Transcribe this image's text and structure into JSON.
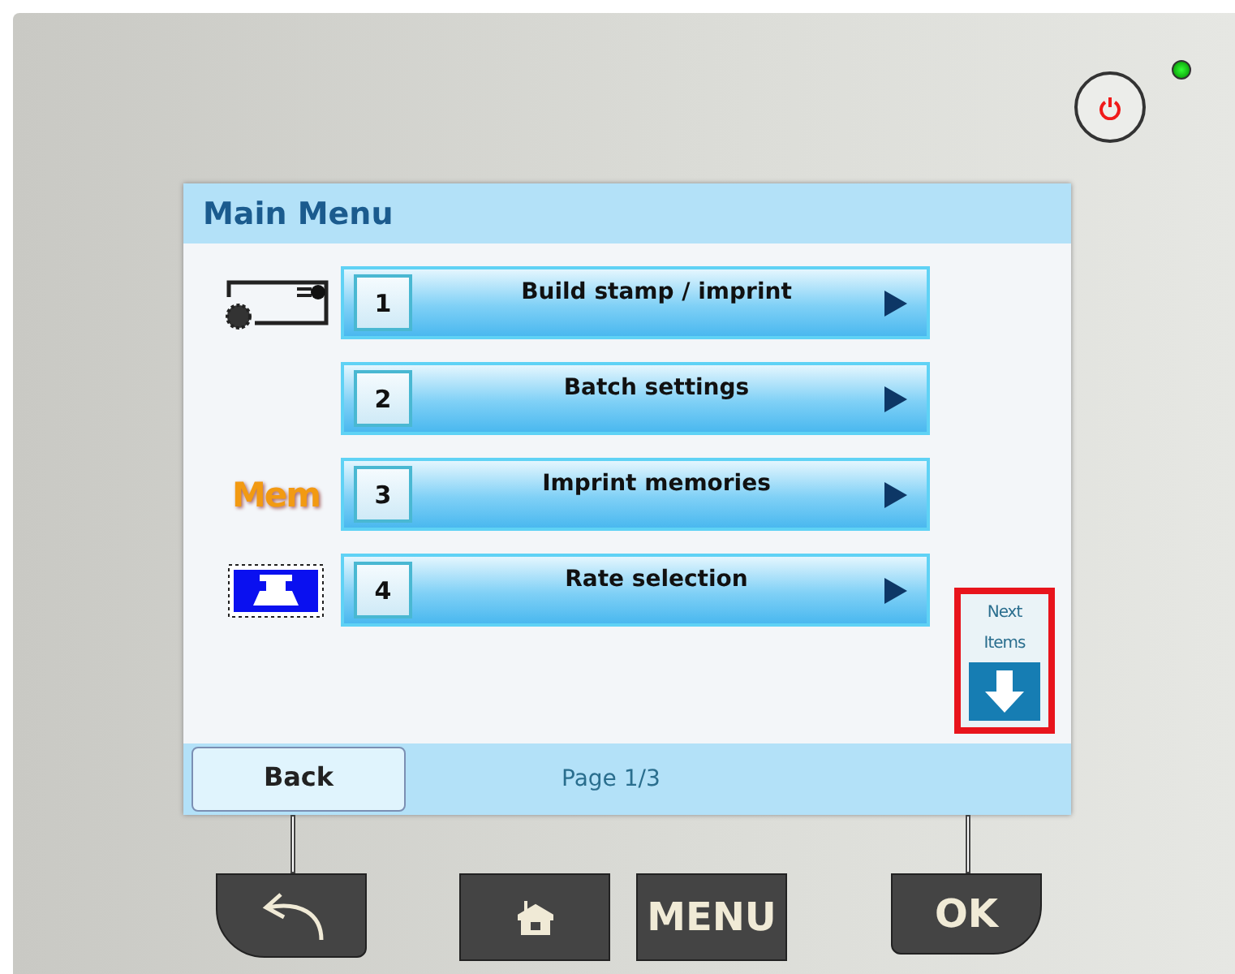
{
  "screen": {
    "title": "Main Menu",
    "items": [
      {
        "number": "1",
        "label": "Build stamp / imprint",
        "icon": {
          "kind": "envelope"
        }
      },
      {
        "number": "2",
        "label": "Batch settings",
        "icon": {
          "kind": "none"
        }
      },
      {
        "number": "3",
        "label": "Imprint memories",
        "icon": {
          "kind": "text",
          "text": "Mem"
        }
      },
      {
        "number": "4",
        "label": "Rate selection",
        "icon": {
          "kind": "stamp"
        }
      }
    ],
    "next": {
      "label": "Next Items",
      "highlighted": true
    },
    "back": "Back",
    "page": "Page 1/3"
  },
  "keys": [
    {
      "kind": "back"
    },
    {
      "kind": "home"
    },
    {
      "kind": "text",
      "label": "MENU"
    },
    {
      "kind": "text",
      "label": "OK"
    }
  ],
  "led": {
    "on": true
  }
}
